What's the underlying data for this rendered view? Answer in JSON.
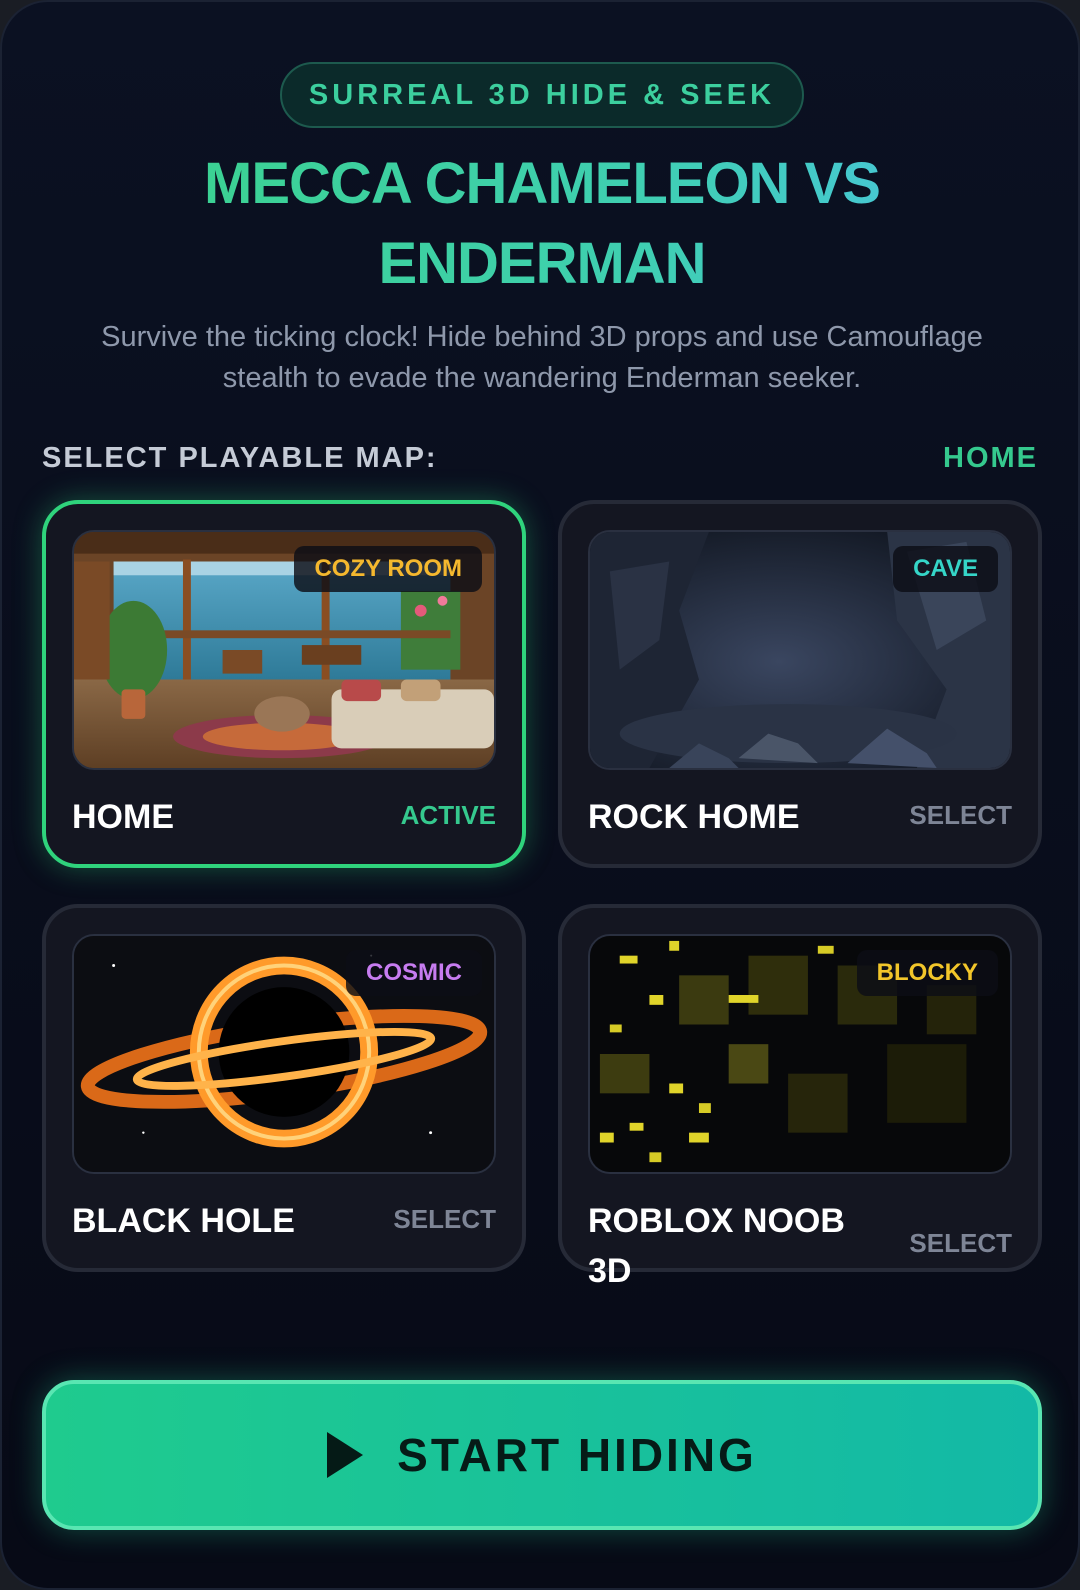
{
  "header": {
    "badge": "SURREAL 3D HIDE & SEEK",
    "title": "MECCA CHAMELEON VS ENDERMAN",
    "subtitle": "Survive the ticking clock! Hide behind 3D props and use Camouflage stealth to evade the wandering Enderman seeker."
  },
  "map_select": {
    "label": "SELECT PLAYABLE MAP:",
    "current": "HOME",
    "maps": [
      {
        "name": "HOME",
        "tag": "COZY ROOM",
        "tag_color": "#f5b82e",
        "action": "ACTIVE",
        "selected": true
      },
      {
        "name": "ROCK HOME",
        "tag": "CAVE",
        "tag_color": "#35d6c8",
        "action": "SELECT",
        "selected": false
      },
      {
        "name": "BLACK HOLE",
        "tag": "COSMIC",
        "tag_color": "#c77cf0",
        "action": "SELECT",
        "selected": false
      },
      {
        "name": "ROBLOX NOOB 3D",
        "tag": "BLOCKY",
        "tag_color": "#f2c62a",
        "action": "SELECT",
        "selected": false
      }
    ]
  },
  "start_button": {
    "label": "START HIDING",
    "icon": "play-icon"
  },
  "colors": {
    "accent": "#2fd37c",
    "background": "#080c18",
    "card": "#141621"
  }
}
